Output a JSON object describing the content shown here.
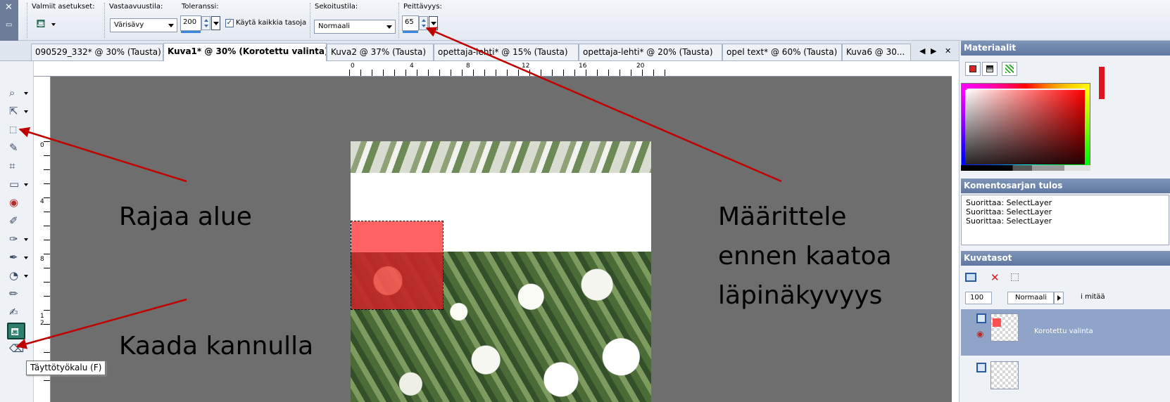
{
  "tool_options": {
    "presets_label": "Valmiit asetukset:",
    "match_mode_label": "Vastaavuustila:",
    "match_mode_value": "Värisävy",
    "tolerance_label": "Toleranssi:",
    "tolerance_value": "200",
    "use_all_layers_label": "Käytä kaikkia tasoja",
    "use_all_layers_checked": "✓",
    "blend_mode_label": "Sekoitustila:",
    "blend_mode_value": "Normaali",
    "opacity_label": "Peittävyys:",
    "opacity_value": "65"
  },
  "tabs": [
    {
      "label": "090529_332* @ 30% (Tausta)"
    },
    {
      "label": "Kuva1* @ 30% (Korotettu valinta)"
    },
    {
      "label": "Kuva2 @ 37% (Tausta)"
    },
    {
      "label": "opettaja-lehti* @ 15% (Tausta)"
    },
    {
      "label": "opettaja-lehti* @ 20% (Tausta)"
    },
    {
      "label": "opel text* @ 60% (Tausta)"
    },
    {
      "label": "Kuva6 @ 30..."
    }
  ],
  "tab_nav": {
    "prev": "◀",
    "next": "▶",
    "close": "✕"
  },
  "ruler_h": [
    "0",
    "4",
    "8",
    "12",
    "16",
    "20"
  ],
  "ruler_v": [
    "0",
    "4",
    "8",
    "1",
    "2"
  ],
  "annotations": {
    "crop_area": "Rajaa alue",
    "fill_with_can": "Kaada kannulla",
    "set_opacity_line1": "Määrittele",
    "set_opacity_line2": "ennen kaatoa",
    "set_opacity_line3": "läpinäkyvyys"
  },
  "tooltip": "Täyttötyökalu (F)",
  "panels": {
    "materials_title": "Materiaalit",
    "script_output_title": "Komentosarjan tulos",
    "script_lines": [
      "Suorittaa: SelectLayer",
      "Suorittaa: SelectLayer",
      "Suorittaa: SelectLayer"
    ],
    "layers_title": "Kuvatasot",
    "layer_opacity": "100",
    "layer_blend": "Normaali",
    "layer_lock_text": "i mitää",
    "layer_name": "Korotettu valinta"
  },
  "colors": {
    "selection_fill": "#ff6262",
    "annotation_arrow": "#c00000",
    "active_tool": "#2f7f6f",
    "panel_title": "#6a82aa"
  }
}
